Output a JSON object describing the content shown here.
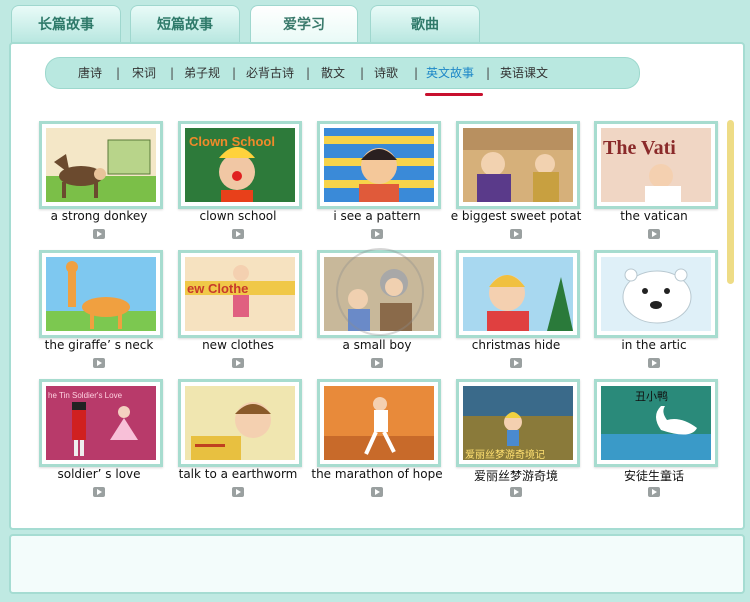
{
  "tabs": [
    {
      "label": "长篇故事",
      "active": false
    },
    {
      "label": "短篇故事",
      "active": false
    },
    {
      "label": "爱学习",
      "active": true
    },
    {
      "label": "歌曲",
      "active": false
    }
  ],
  "subnav": {
    "items": [
      "唐诗",
      "宋词",
      "弟子规",
      "必背古诗",
      "散文",
      "诗歌",
      "英文故事",
      "英语课文"
    ],
    "active": "英文故事",
    "separator": "|"
  },
  "stories": [
    {
      "title": "a strong donkey"
    },
    {
      "title": "clown school",
      "image_text": "Clown School"
    },
    {
      "title": "i see a pattern"
    },
    {
      "title": "e biggest sweet potat"
    },
    {
      "title": "the vatican",
      "image_text": "The Vati"
    },
    {
      "title": "the giraffe’ s neck"
    },
    {
      "title": "new clothes",
      "image_text": "ew Clothe"
    },
    {
      "title": "a small boy"
    },
    {
      "title": "christmas hide"
    },
    {
      "title": "in the artic"
    },
    {
      "title": "soldier’ s love",
      "image_text": "he Tin Soldier's Love"
    },
    {
      "title": "talk to a earthworm"
    },
    {
      "title": "the marathon of hope"
    },
    {
      "title": "爱丽丝梦游奇境",
      "image_text": "爱丽丝梦游奇境记"
    },
    {
      "title": "安徒生童话",
      "image_text": "丑小鸭"
    }
  ],
  "colors": {
    "background": "#bfe9e2",
    "tab_text": "#2f7a6a",
    "underline": "#c8102e",
    "subnav_active": "#1e88c8",
    "card_border": "#a7dccf",
    "scrollbar": "#eedc86"
  }
}
